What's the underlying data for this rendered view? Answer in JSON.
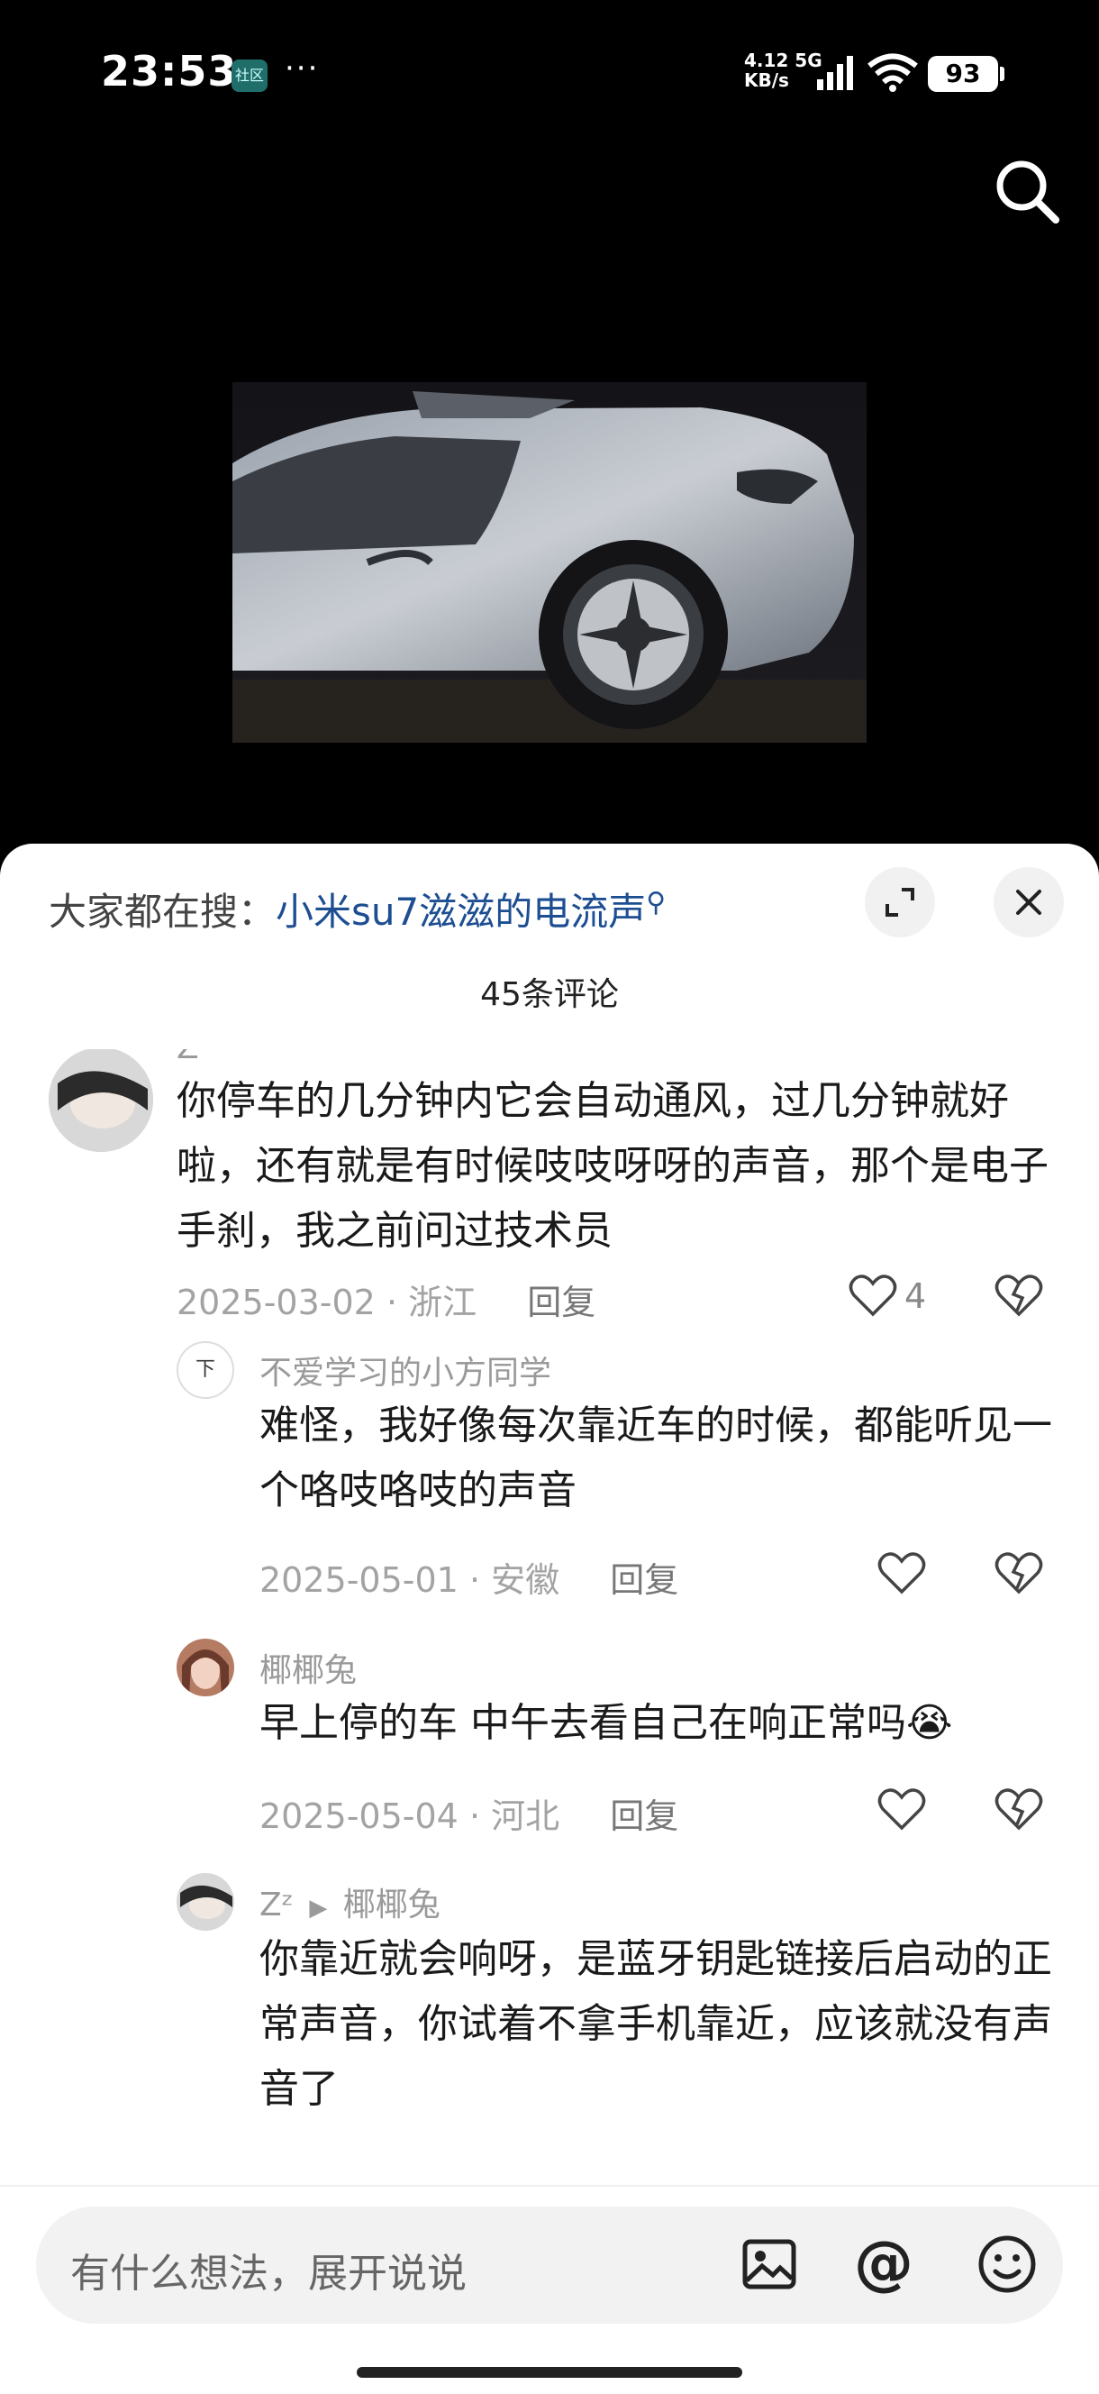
{
  "status_bar": {
    "time": "23:53",
    "badge": "社区",
    "dots": "···",
    "net_speed_top": "4.12 5G",
    "net_speed_bottom": "KB/s",
    "battery": "93"
  },
  "colors": {
    "link": "#1d4e92",
    "sheet_bg": "#ffffff",
    "page_bg": "#000000"
  },
  "header": {
    "hot_search_prefix": "大家都在搜：",
    "hot_search_term": "小米su7滋滋的电流声",
    "comment_count": "45条评论"
  },
  "comments": [
    {
      "username": "Z",
      "text": "你停车的几分钟内它会自动通风，过几分钟就好啦，还有就是有时候吱吱呀呀的声音，那个是电子手刹，我之前问过技术员",
      "date": "2025-03-02",
      "sep": "·",
      "location": "浙江",
      "reply_label": "回复",
      "likes": "4"
    },
    {
      "username": "不爱学习的小方同学",
      "text": "难怪，我好像每次靠近车的时候，都能听见一个咯吱咯吱的声音",
      "date": "2025-05-01",
      "sep": "·",
      "location": "安徽",
      "reply_label": "回复",
      "likes": ""
    },
    {
      "username": "椰椰兔",
      "text": "早上停的车 中午去看自己在响正常吗😭",
      "date": "2025-05-04",
      "sep": "·",
      "location": "河北",
      "reply_label": "回复",
      "likes": ""
    },
    {
      "username": "Zᶻ",
      "reply_arrow": "▶",
      "reply_to": "椰椰兔",
      "text": "你靠近就会响呀，是蓝牙钥匙链接后启动的正常声音，你试着不拿手机靠近，应该就没有声音了"
    }
  ],
  "input": {
    "placeholder": "有什么想法，展开说说",
    "at_symbol": "@"
  }
}
